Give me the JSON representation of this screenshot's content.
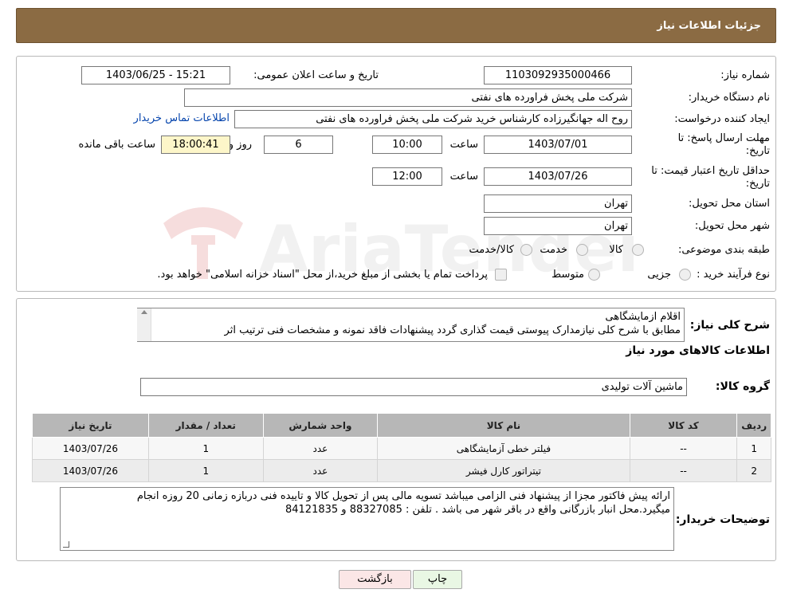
{
  "header": {
    "title": "جزئیات اطلاعات نیاز"
  },
  "form": {
    "need_number_label": "شماره نیاز:",
    "need_number": "1103092935000466",
    "announce_label": "تاریخ و ساعت اعلان عمومی:",
    "announce_value": "1403/06/25 - 15:21",
    "buyer_org_label": "نام دستگاه خریدار:",
    "buyer_org": "شرکت ملی پخش فراورده های نفتی",
    "creator_label": "ایجاد کننده درخواست:",
    "creator": "روح اله جهانگیرزاده کارشناس خرید شرکت ملی پخش فراورده های نفتی",
    "contact_link": "اطلاعات تماس خریدار",
    "deadline_label_1": "مهلت ارسال پاسخ: تا",
    "deadline_label_2": "تاریخ:",
    "deadline_date": "1403/07/01",
    "time_label": "ساعت",
    "deadline_time": "10:00",
    "days_value": "6",
    "days_label": "روز و",
    "remaining_time": "18:00:41",
    "remaining_label": "ساعت باقی مانده",
    "validity_label_1": "حداقل تاریخ اعتبار قیمت: تا",
    "validity_label_2": "تاریخ:",
    "validity_date": "1403/07/26",
    "validity_time": "12:00",
    "province_label": "استان محل تحویل:",
    "province": "تهران",
    "city_label": "شهر محل تحویل:",
    "city": "تهران",
    "category_label": "طبقه بندی موضوعی:",
    "category_options": [
      "کالا",
      "خدمت",
      "کالا/خدمت"
    ],
    "process_label": "نوع فرآیند خرید :",
    "process_options": [
      "جزیی",
      "متوسط"
    ],
    "process_note": "پرداخت تمام یا بخشی از مبلغ خرید،از محل \"اسناد خزانه اسلامی\" خواهد بود."
  },
  "summary": {
    "label": "شرح کلی نیاز:",
    "line1": "اقلام ازمایشگاهی",
    "line2": "مطابق با شرح کلی نیازمدارک پیوستی قیمت گذاری گردد پیشنهادات فاقد نمونه و مشخصات فنی ترتیب اثر"
  },
  "goods": {
    "section_title": "اطلاعات کالاهای مورد نیاز",
    "group_label": "گروه کالا:",
    "group_value": "ماشین آلات تولیدی",
    "columns": [
      "ردیف",
      "کد کالا",
      "نام کالا",
      "واحد شمارش",
      "تعداد / مقدار",
      "تاریخ نیاز"
    ],
    "rows": [
      [
        "1",
        "--",
        "فیلتر خطی آزمایشگاهی",
        "عدد",
        "1",
        "1403/07/26"
      ],
      [
        "2",
        "--",
        "تیتراتور کارل فیشر",
        "عدد",
        "1",
        "1403/07/26"
      ]
    ]
  },
  "notes": {
    "label": "توضیحات خریدار:",
    "line1": "ارائه پیش فاکتور مجزا از پیشنهاد فنی الزامی میباشد تسویه مالی پس از تحویل کالا و تاییده فنی دربازه زمانی 20 روزه انجام",
    "line2": "میگیرد.محل انبار بازرگانی واقع در باقر شهر می باشد . تلفن : 88327085 و 84121835"
  },
  "buttons": {
    "print": "چاپ",
    "back": "بازگشت"
  },
  "watermark": {
    "text": "AriaTender.neT"
  },
  "colors": {
    "header_bg": "#8b6b43",
    "link": "#0645ad",
    "remaining_bg": "#fdf6c9",
    "print_bg": "#e9f7e4",
    "back_bg": "#fbe6e6"
  }
}
